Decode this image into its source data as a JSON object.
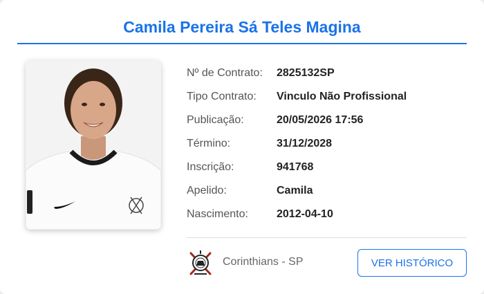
{
  "athlete": {
    "name": "Camila Pereira Sá Teles Magina"
  },
  "details": [
    {
      "label": "Nº de Contrato:",
      "value": "2825132SP"
    },
    {
      "label": "Tipo Contrato:",
      "value": "Vinculo Não Profissional"
    },
    {
      "label": "Publicação:",
      "value": "20/05/2026 17:56"
    },
    {
      "label": "Término:",
      "value": "31/12/2028"
    },
    {
      "label": "Inscrição:",
      "value": "941768"
    },
    {
      "label": "Apelido:",
      "value": "Camila"
    },
    {
      "label": "Nascimento:",
      "value": "2012-04-10"
    }
  ],
  "club": {
    "name": "Corinthians - SP",
    "logo_icon": "corinthians-crest-icon"
  },
  "actions": {
    "history_label": "VER HISTÓRICO"
  },
  "colors": {
    "accent": "#1a73e8",
    "label": "#555555",
    "value": "#222222"
  }
}
